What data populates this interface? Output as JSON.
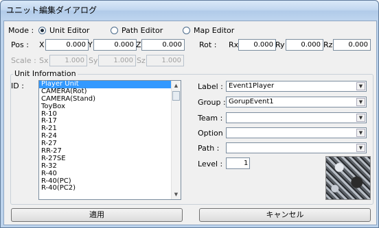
{
  "window": {
    "title": "ユニット編集ダイアログ"
  },
  "mode": {
    "label": "Mode :",
    "options": [
      {
        "label": "Unit Editor",
        "checked": true
      },
      {
        "label": "Path Editor",
        "checked": false
      },
      {
        "label": "Map Editor",
        "checked": false
      }
    ]
  },
  "pos": {
    "label": "Pos :",
    "x_label": "X",
    "y_label": "Y",
    "z_label": "Z",
    "x": "0.000",
    "y": "0.000",
    "z": "0.000"
  },
  "rot": {
    "label": "Rot :",
    "rx_label": "Rx",
    "ry_label": "Ry",
    "rz_label": "Rz",
    "rx": "0.000",
    "ry": "0.000",
    "rz": "0.000"
  },
  "scale": {
    "label": "Scale :",
    "sx_label": "Sx",
    "sy_label": "Sy",
    "sz_label": "Sz",
    "sx": "1.000",
    "sy": "1.000",
    "sz": "1.000"
  },
  "unit_info": {
    "group_label": "Unit Information",
    "id_label": "ID :",
    "ids": [
      "Player Unit",
      "CAMERA(Rot)",
      "CAMERA(Stand)",
      "ToyBox",
      "R-10",
      "R-17",
      "R-21",
      "R-24",
      "R-27",
      "RR-27",
      "R-27SE",
      "R-32",
      "R-40",
      "R-40(PC)",
      "R-40(PC2)"
    ],
    "selected_index": 0,
    "label_label": "Label :",
    "label_value": "Event1Player",
    "group_label2": "Group :",
    "group_value": "GorupEvent1",
    "team_label": "Team :",
    "team_value": "",
    "option_label": "Option :",
    "option_value": "",
    "path_label": "Path :",
    "path_value": "",
    "level_label": "Level :",
    "level_value": "1"
  },
  "buttons": {
    "apply": "適用",
    "cancel": "キャンセル"
  }
}
